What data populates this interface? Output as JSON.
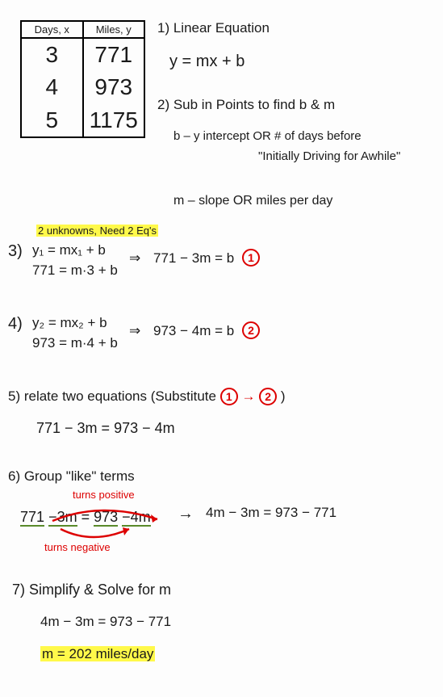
{
  "table": {
    "headers": [
      "Days, x",
      "Miles, y"
    ],
    "rows": [
      [
        "3",
        "771"
      ],
      [
        "4",
        "973"
      ],
      [
        "5",
        "1175"
      ]
    ]
  },
  "step1": {
    "title": "1) Linear Equation",
    "eq": "y = mx + b"
  },
  "step2": {
    "title": "2) Sub in Points to find b & m",
    "line_b": "b – y intercept OR # of days before",
    "line_b2": "\"Initially Driving for Awhile\"",
    "line_m": "m – slope OR miles per day"
  },
  "note": "2 unknowns, Need 2 Eq's",
  "step3": {
    "title": "3)",
    "l1": "y₁ = mx₁ + b",
    "l2": "771 = m·3 + b",
    "arrow": "⇒",
    "r": "771 − 3m = b"
  },
  "step4": {
    "title": "4)",
    "l1": "y₂ = mx₂ + b",
    "l2": "973 = m·4 + b",
    "arrow": "⇒",
    "r": "973 − 4m = b"
  },
  "step5": {
    "title": "5) relate two equations (Substitute",
    "sub_arrow": "→",
    "close": ")",
    "eq": "771 − 3m = 973 − 4m"
  },
  "step6": {
    "title": "6) Group \"like\" terms",
    "top_note": "turns positive",
    "bot_note": "turns negative",
    "left_a": "771",
    "left_b": "−3m",
    "left_c": "973",
    "left_d": "−4m",
    "arrow": "→",
    "right": "4m − 3m = 973 − 771"
  },
  "step7": {
    "title": "7) Simplify & Solve for m",
    "eq": "4m − 3m = 973 − 771",
    "ans": "m = 202 miles/day"
  }
}
